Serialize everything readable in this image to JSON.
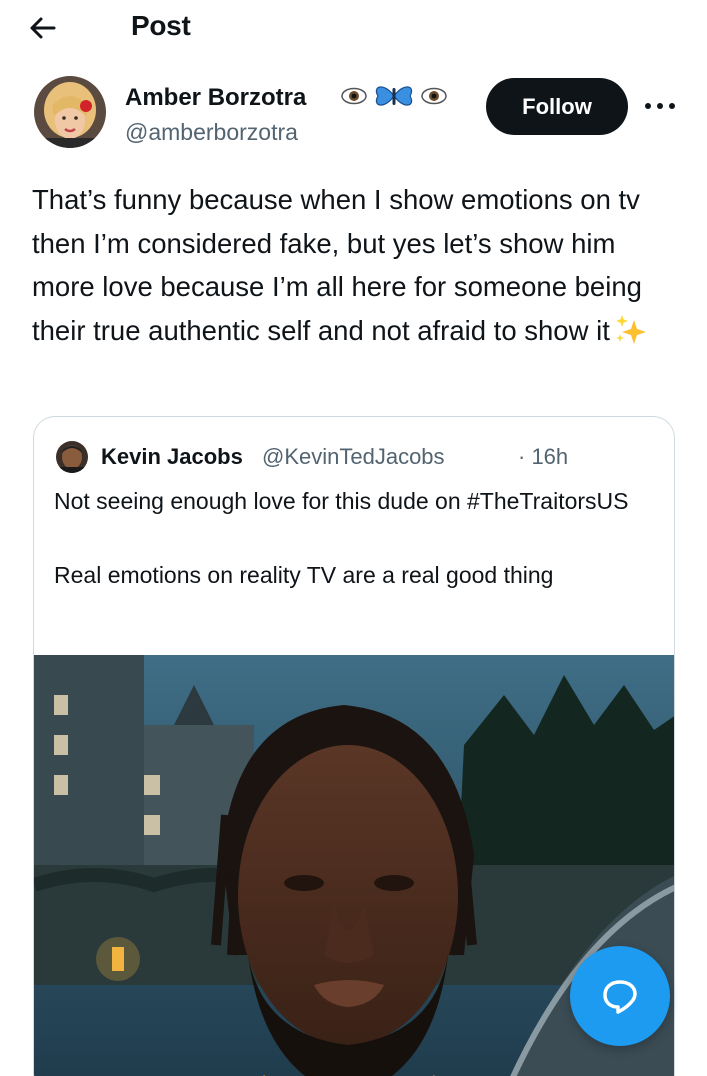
{
  "topbar": {
    "title": "Post"
  },
  "author": {
    "name": "Amber Borzotra",
    "name_emoji": "👁🦋👁",
    "handle": "@amberborzotra"
  },
  "follow_label": "Follow",
  "post": {
    "text": "That’s funny because when I show emotions on tv then I’m considered fake, but yes let’s show him more love because I’m all here for someone being their true authentic self and not afraid to show it",
    "trailing_emoji": "✨"
  },
  "quote": {
    "name": "Kevin Jacobs",
    "handle": "@KevinTedJacobs",
    "time": "· 16h",
    "line1": "Not seeing enough love for this dude on #TheTraitorsUS",
    "line2": "Real emotions on reality TV are a real good thing"
  },
  "icons": {
    "back": "arrow-left-icon",
    "more": "more-horizontal-icon",
    "compose": "reply-bubble-icon"
  },
  "colors": {
    "accent": "#1d9bf0",
    "text": "#0f1419",
    "secondary": "#536471",
    "follow_bg": "#0f1419"
  }
}
